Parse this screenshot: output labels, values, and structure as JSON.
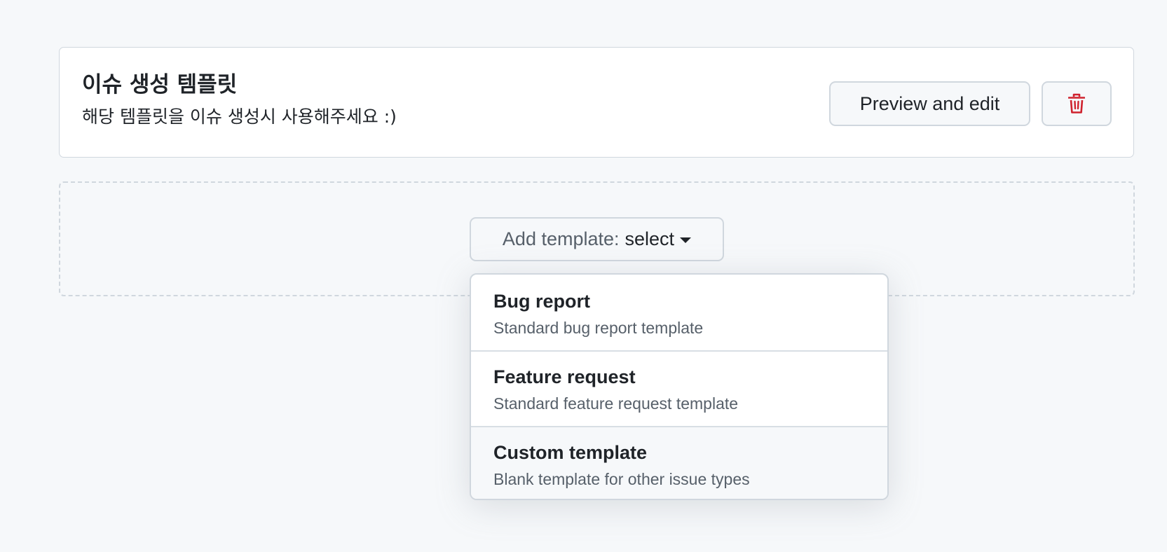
{
  "template": {
    "title": "이슈 생성 템플릿",
    "description": "해당 템플릿을 이슈 생성시 사용해주세요 :)",
    "preview_label": "Preview and edit",
    "delete_icon": "trash-icon"
  },
  "add_template": {
    "label": "Add template:",
    "value": "select",
    "icon": "triangle-down-icon"
  },
  "dropdown": {
    "items": [
      {
        "title": "Bug report",
        "description": "Standard bug report template"
      },
      {
        "title": "Feature request",
        "description": "Standard feature request template"
      },
      {
        "title": "Custom template",
        "description": "Blank template for other issue types"
      }
    ]
  },
  "colors": {
    "page_background": "#f6f8fa",
    "border": "#d0d7de",
    "danger": "#cf222e",
    "muted_text": "#57606a"
  }
}
